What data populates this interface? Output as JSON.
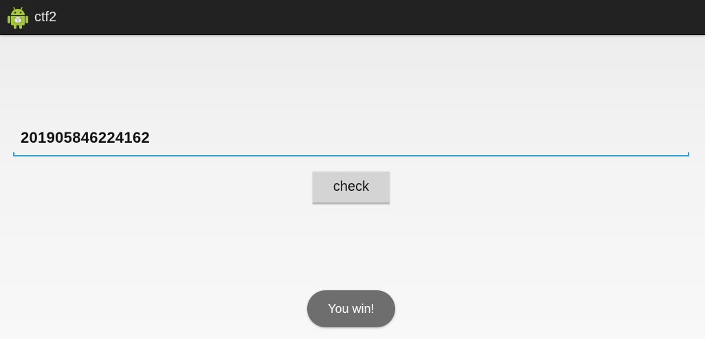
{
  "actionbar": {
    "title": "ctf2",
    "icon": "android-robot-icon",
    "background_color": "#222222"
  },
  "input": {
    "value": "201905846224162",
    "underline_color": "#2ba1d6"
  },
  "check_button": {
    "label": "check"
  },
  "toast": {
    "message": "You win!"
  }
}
